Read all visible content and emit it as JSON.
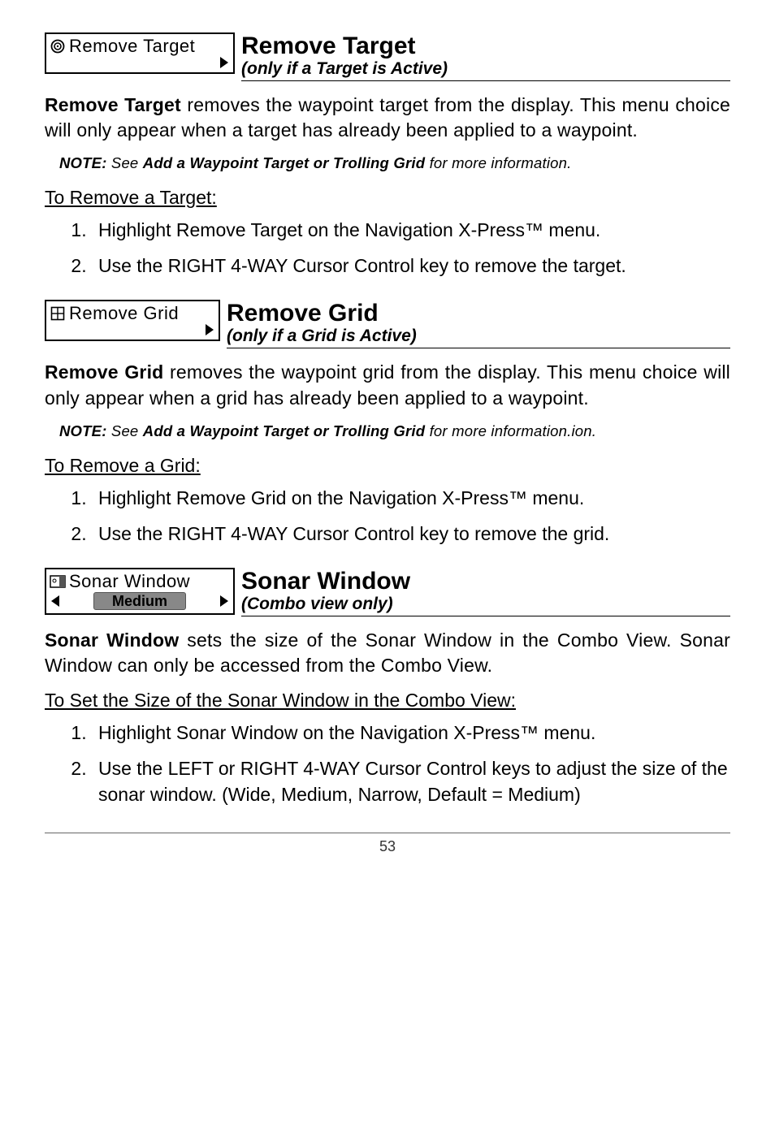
{
  "sections": [
    {
      "widget_label": "Remove Target",
      "title": "Remove Target",
      "subtitle": "(only if a Target is Active)",
      "body_bold": "Remove Target",
      "body_rest": " removes the waypoint  target from the display. This menu choice will only appear when a target has already been applied to a waypoint.",
      "note_prefix": "NOTE:",
      "note_mid": "  See ",
      "note_bold": "Add a Waypoint Target or Trolling Grid",
      "note_end": " for more information.",
      "subhead": "To Remove a Target:",
      "steps": [
        "Highlight Remove Target on the Navigation X-Press™ menu.",
        "Use the RIGHT 4-WAY Cursor Control key to remove the target."
      ]
    },
    {
      "widget_label": "Remove Grid",
      "title": "Remove Grid",
      "subtitle": "(only if a Grid is Active)",
      "body_bold": "Remove Grid",
      "body_rest": " removes the waypoint grid from the display. This menu choice will only appear when a grid has already been applied to a waypoint.",
      "note_prefix": "NOTE:",
      "note_mid": "  See ",
      "note_bold": "Add a Waypoint Target or Trolling Grid",
      "note_end": " for more information.ion.",
      "subhead": "To Remove a Grid:",
      "steps": [
        "Highlight Remove Grid on the Navigation X-Press™ menu.",
        "Use the RIGHT 4-WAY Cursor Control key to remove the grid."
      ]
    },
    {
      "widget_label": "Sonar Window",
      "widget_value": "Medium",
      "title": "Sonar Window",
      "subtitle": "(Combo view only)",
      "body_bold": "Sonar Window",
      "body_rest": " sets the size of the Sonar Window in the Combo View. Sonar Window can only be accessed from the Combo View.",
      "subhead": "To Set the Size of the Sonar Window in the Combo View:",
      "steps": [
        "Highlight Sonar Window on the Navigation X-Press™ menu.",
        "Use the LEFT or RIGHT 4-WAY Cursor Control keys to adjust the size of the sonar window. (Wide, Medium, Narrow, Default = Medium)"
      ]
    }
  ],
  "page_number": "53"
}
